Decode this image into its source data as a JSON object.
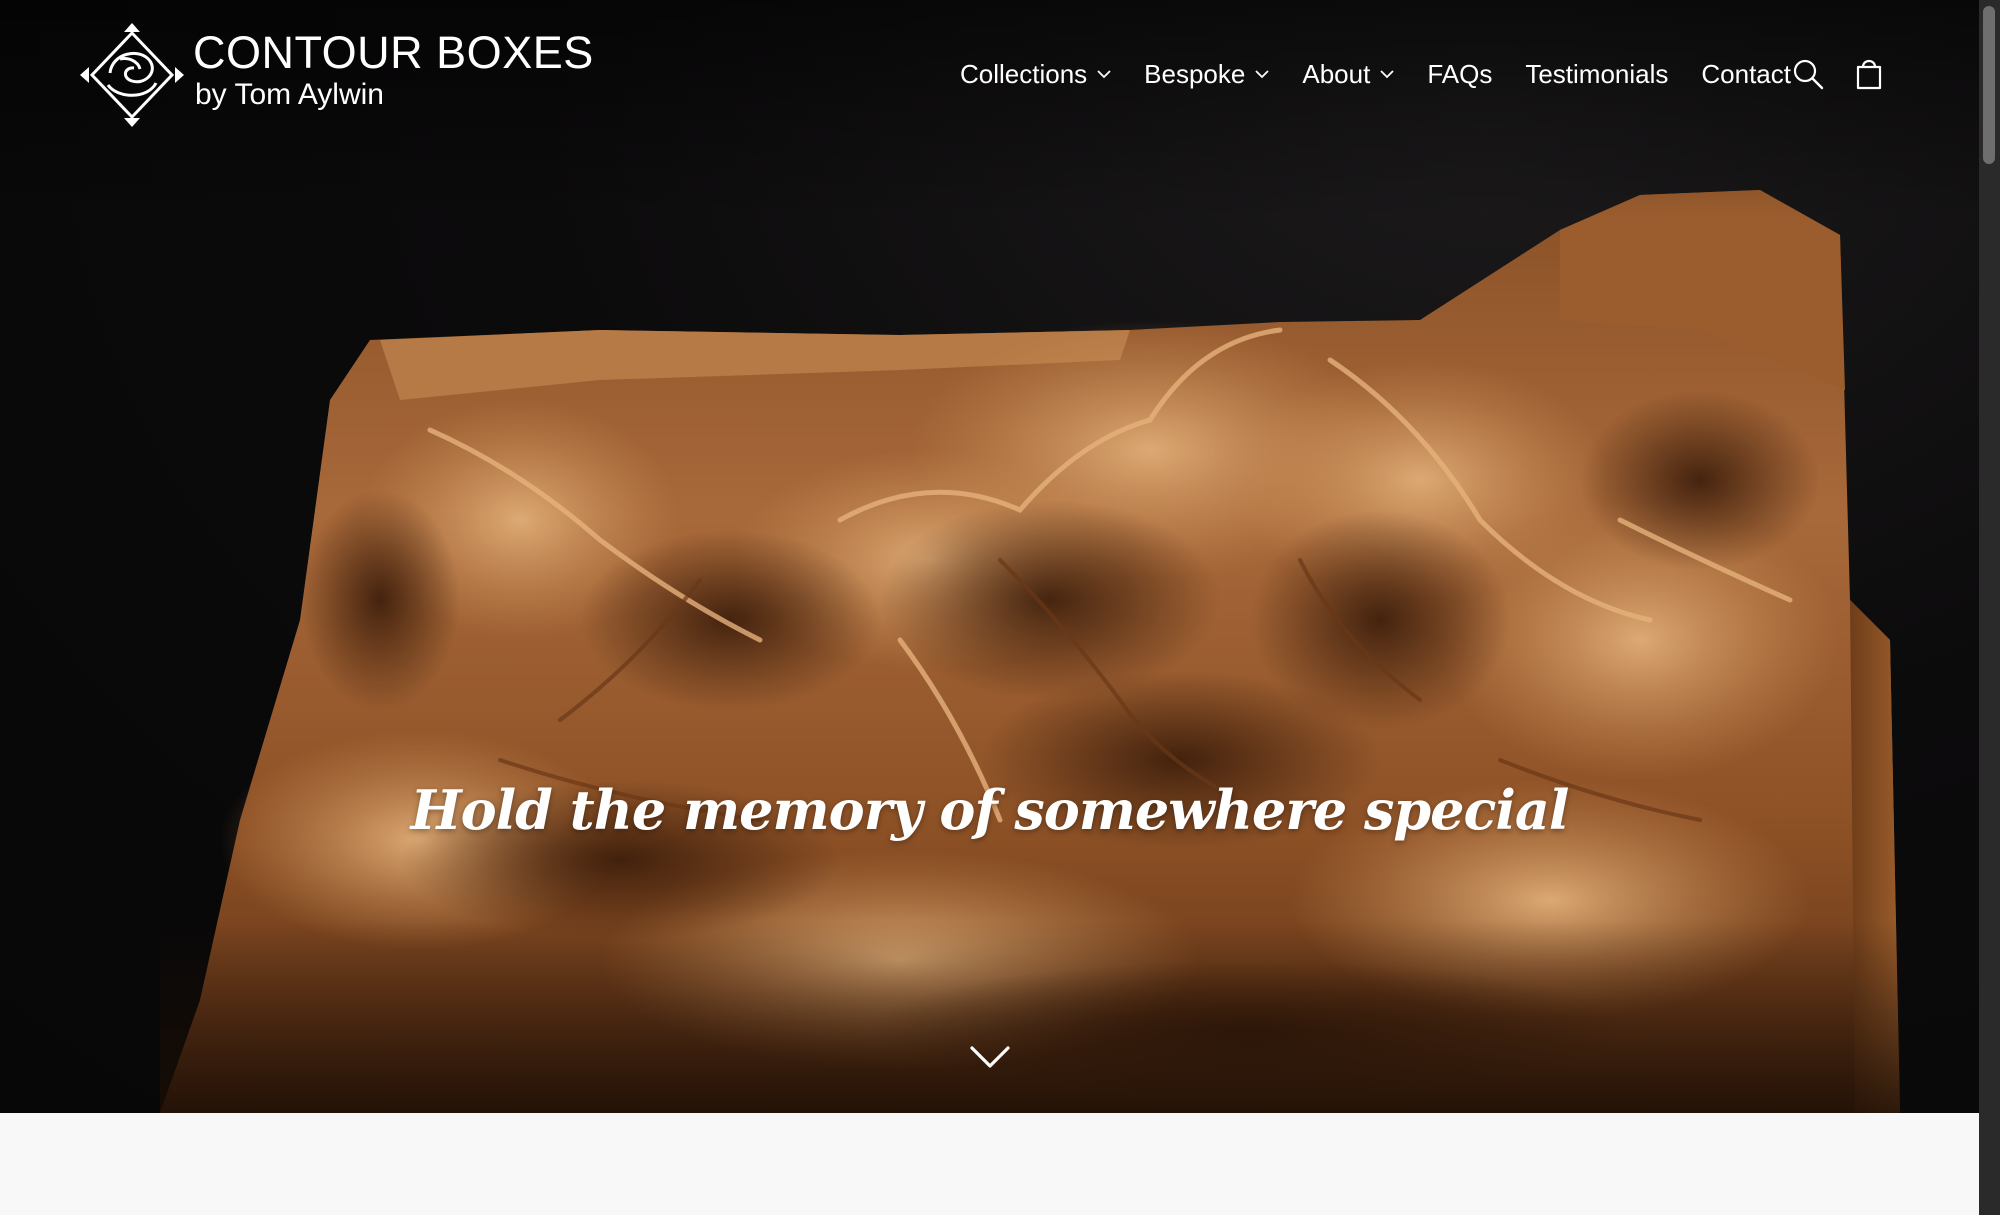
{
  "brand": {
    "name": "CONTOUR BOXES",
    "tagline": "by Tom Aylwin"
  },
  "nav": {
    "items": [
      {
        "label": "Collections",
        "has_dropdown": true
      },
      {
        "label": "Bespoke",
        "has_dropdown": true
      },
      {
        "label": "About",
        "has_dropdown": true
      },
      {
        "label": "FAQs",
        "has_dropdown": false
      },
      {
        "label": "Testimonials",
        "has_dropdown": false
      },
      {
        "label": "Contact",
        "has_dropdown": false
      }
    ]
  },
  "header_icons": [
    "search-icon",
    "cart-icon"
  ],
  "hero": {
    "headline": "Hold the memory of somewhere special",
    "scroll_icon": "chevron-down-icon"
  },
  "colors": {
    "hero_background": "#0a0a0a",
    "wood_light": "#c98d55",
    "wood_dark": "#4a2713",
    "text": "#ffffff",
    "below_fold": "#f8f8f8"
  }
}
